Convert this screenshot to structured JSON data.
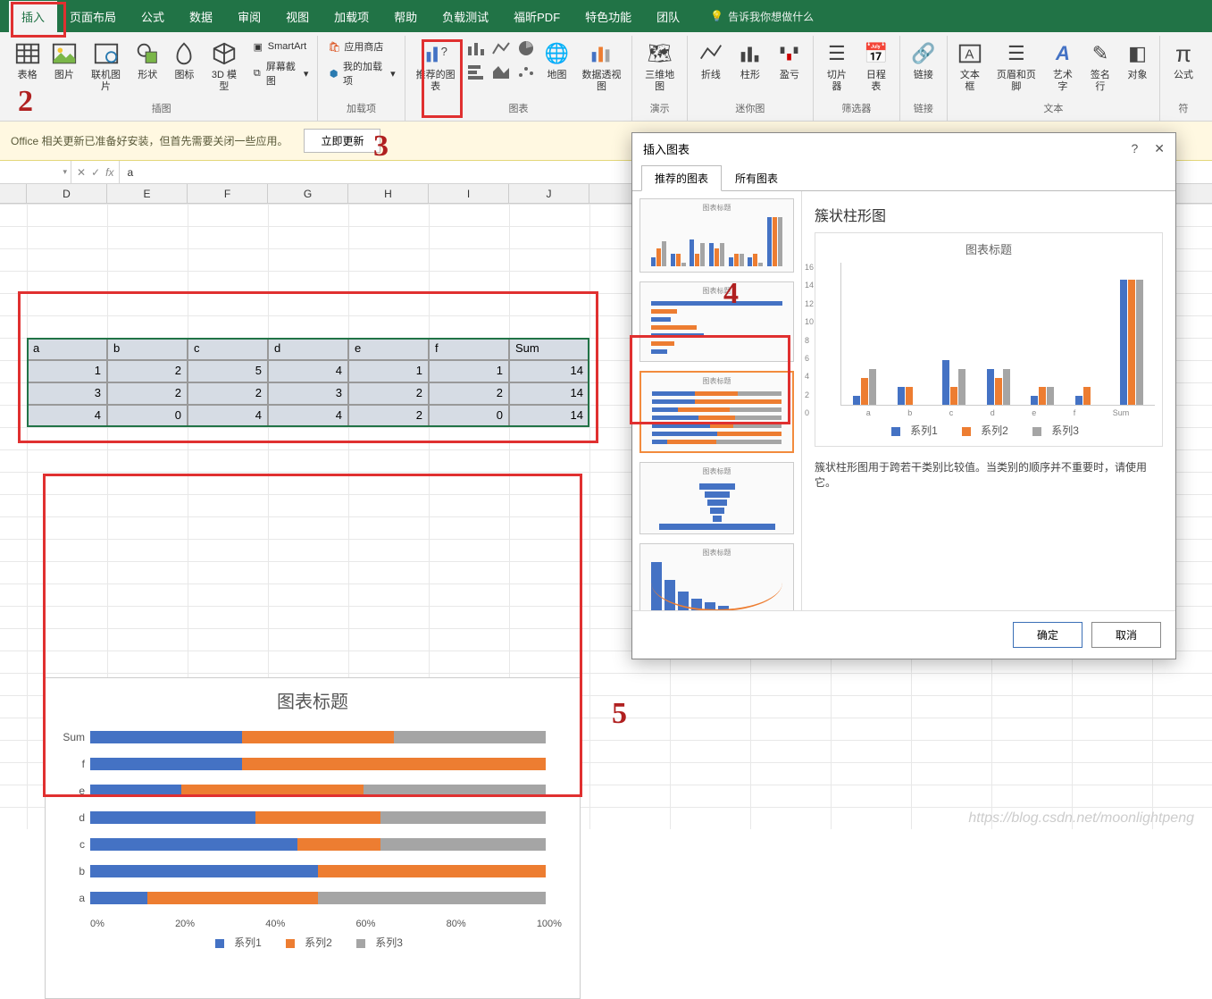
{
  "ribbon": {
    "tabs": [
      "插入",
      "页面布局",
      "公式",
      "数据",
      "审阅",
      "视图",
      "加载项",
      "帮助",
      "负载测试",
      "福昕PDF",
      "特色功能",
      "团队"
    ],
    "active_tab": "插入",
    "tell_me_placeholder": "告诉我你想做什么",
    "groups": {
      "illustrations": {
        "label": "插图",
        "table": "表格",
        "pictures": "图片",
        "online_pic": "联机图片",
        "shapes": "形状",
        "icons": "图标",
        "model3d": "3D 模型",
        "smartart": "SmartArt",
        "screenshot": "屏幕截图"
      },
      "addins": {
        "label": "加载项",
        "store": "应用商店",
        "myaddins": "我的加载项"
      },
      "charts": {
        "label": "图表",
        "recommended": "推荐的图表",
        "maps": "地图",
        "pivotchart": "数据透视图"
      },
      "tours": {
        "label": "演示",
        "map3d": "三维地图"
      },
      "sparklines": {
        "label": "迷你图",
        "line": "折线",
        "column": "柱形",
        "winloss": "盈亏"
      },
      "filters": {
        "label": "筛选器",
        "slicer": "切片器",
        "timeline": "日程表"
      },
      "links": {
        "label": "链接",
        "link": "链接"
      },
      "text": {
        "label": "文本",
        "textbox": "文本框",
        "headerfooter": "页眉和页脚",
        "wordart": "艺术字",
        "sigline": "签名行",
        "object": "对象"
      },
      "symbols": {
        "label": "符",
        "equation": "公式"
      }
    }
  },
  "update_bar": {
    "msg": "Office 相关更新已准备好安装，但首先需要关闭一些应用。",
    "btn": "立即更新"
  },
  "formula_bar": {
    "name_box": "",
    "value": "a"
  },
  "columns": [
    "D",
    "E",
    "F",
    "G",
    "H",
    "I",
    "J"
  ],
  "table": {
    "headers": [
      "a",
      "b",
      "c",
      "d",
      "e",
      "f",
      "Sum"
    ],
    "rows": [
      [
        1,
        2,
        5,
        4,
        1,
        1,
        14
      ],
      [
        3,
        2,
        2,
        3,
        2,
        2,
        14
      ],
      [
        4,
        0,
        4,
        4,
        2,
        0,
        14
      ]
    ]
  },
  "embedded_chart": {
    "title": "图表标题",
    "categories": [
      "Sum",
      "f",
      "e",
      "d",
      "c",
      "b",
      "a"
    ],
    "axis": [
      "0%",
      "20%",
      "40%",
      "60%",
      "80%",
      "100%"
    ],
    "legend": [
      "系列1",
      "系列2",
      "系列3"
    ]
  },
  "dialog": {
    "title": "插入图表",
    "tabs": [
      "推荐的图表",
      "所有图表"
    ],
    "preview_name": "簇状柱形图",
    "preview_chart_title": "图表标题",
    "desc": "簇状柱形图用于跨若干类别比较值。当类别的顺序并不重要时，请使用它。",
    "thumb_title": "图表标题",
    "ok": "确定",
    "cancel": "取消",
    "legend": [
      "系列1",
      "系列2",
      "系列3"
    ]
  },
  "chart_data": [
    {
      "type": "bar_stacked_100",
      "title": "图表标题",
      "orientation": "horizontal",
      "categories": [
        "a",
        "b",
        "c",
        "d",
        "e",
        "f",
        "Sum"
      ],
      "series": [
        {
          "name": "系列1",
          "values": [
            1,
            2,
            5,
            4,
            1,
            1,
            14
          ]
        },
        {
          "name": "系列2",
          "values": [
            3,
            2,
            2,
            3,
            2,
            2,
            14
          ]
        },
        {
          "name": "系列3",
          "values": [
            4,
            0,
            4,
            4,
            2,
            0,
            14
          ]
        }
      ],
      "xlabel": "",
      "ylabel": "",
      "xlim": [
        0,
        100
      ],
      "x_ticks": [
        0,
        20,
        40,
        60,
        80,
        100
      ]
    },
    {
      "type": "bar",
      "title": "图表标题",
      "subtitle": "簇状柱形图",
      "categories": [
        "a",
        "b",
        "c",
        "d",
        "e",
        "f",
        "Sum"
      ],
      "series": [
        {
          "name": "系列1",
          "values": [
            1,
            2,
            5,
            4,
            1,
            1,
            14
          ]
        },
        {
          "name": "系列2",
          "values": [
            3,
            2,
            2,
            3,
            2,
            2,
            14
          ]
        },
        {
          "name": "系列3",
          "values": [
            4,
            0,
            4,
            4,
            2,
            0,
            14
          ]
        }
      ],
      "ylim": [
        0,
        16
      ],
      "y_ticks": [
        0,
        2,
        4,
        6,
        8,
        10,
        12,
        14,
        16
      ]
    }
  ],
  "annotations": {
    "n2": "2",
    "n3": "3",
    "n4": "4",
    "n5": "5"
  },
  "watermark": "https://blog.csdn.net/moonlightpeng"
}
